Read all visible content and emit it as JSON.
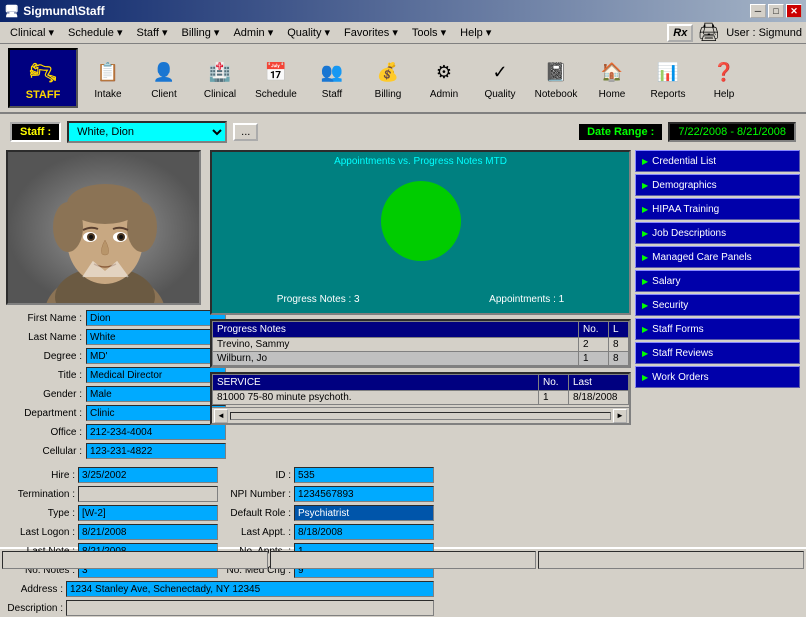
{
  "titlebar": {
    "title": "Sigmund\\Staff",
    "min": "─",
    "max": "□",
    "close": "✕"
  },
  "menubar": {
    "items": [
      {
        "label": "Clinical"
      },
      {
        "label": "Schedule"
      },
      {
        "label": "Staff"
      },
      {
        "label": "Billing"
      },
      {
        "label": "Admin"
      },
      {
        "label": "Quality"
      },
      {
        "label": "Favorites"
      },
      {
        "label": "Tools"
      },
      {
        "label": "Help"
      }
    ]
  },
  "toolbar": {
    "staff_label": "STAFF",
    "items": [
      {
        "label": "Intake",
        "icon": "📋"
      },
      {
        "label": "Client",
        "icon": "👤"
      },
      {
        "label": "Clinical",
        "icon": "🏥"
      },
      {
        "label": "Schedule",
        "icon": "📅"
      },
      {
        "label": "Staff",
        "icon": "👥"
      },
      {
        "label": "Billing",
        "icon": "💰"
      },
      {
        "label": "Admin",
        "icon": "⚙"
      },
      {
        "label": "Quality",
        "icon": "✓"
      },
      {
        "label": "Notebook",
        "icon": "📓"
      },
      {
        "label": "Home",
        "icon": "🏠"
      },
      {
        "label": "Reports",
        "icon": "📊"
      },
      {
        "label": "Help",
        "icon": "❓"
      }
    ],
    "rx_symbol": "Rx",
    "user_label": "User : Sigmund"
  },
  "selector": {
    "staff_label": "Staff :",
    "selected_staff": "White, Dion",
    "dots": "...",
    "date_range_label": "Date Range :",
    "date_range": "7/22/2008 - 8/21/2008"
  },
  "staff_info": {
    "first_name_label": "First Name :",
    "first_name": "Dion",
    "last_name_label": "Last Name :",
    "last_name": "White",
    "degree_label": "Degree :",
    "degree": "MD'",
    "title_label": "Title :",
    "title": "Medical Director",
    "gender_label": "Gender :",
    "gender": "Male",
    "department_label": "Department :",
    "department": "Clinic",
    "office_label": "Office :",
    "office": "212-234-4004",
    "cellular_label": "Cellular :",
    "cellular": "123-231-4822"
  },
  "staff_details": {
    "hire_label": "Hire :",
    "hire": "3/25/2002",
    "id_label": "ID :",
    "id": "535",
    "termination_label": "Termination :",
    "termination": "",
    "npi_label": "NPI Number :",
    "npi": "1234567893",
    "type_label": "Type :",
    "type": "[W-2]",
    "default_role_label": "Default Role :",
    "default_role": "Psychiatrist",
    "last_logon_label": "Last Logon :",
    "last_logon": "8/21/2008",
    "last_appt_label": "Last Appt. :",
    "last_appt": "8/18/2008",
    "last_note_label": "Last Note :",
    "last_note": "8/21/2008",
    "no_appts_label": "No. Appts. :",
    "no_appts": "1",
    "no_notes_label": "No. Notes :",
    "no_notes": "3",
    "no_med_chg_label": "No. Med Chg :",
    "no_med_chg": "9",
    "address_label": "Address :",
    "address": "1234 Stanley Ave, Schenectady, NY 12345",
    "description_label": "Description :",
    "description": ""
  },
  "chart": {
    "title": "Appointments vs. Progress Notes MTD",
    "progress_notes_label": "Progress Notes : 3",
    "appointments_label": "Appointments : 1"
  },
  "progress_notes_table": {
    "headers": [
      "Progress Notes",
      "No.",
      "L"
    ],
    "rows": [
      [
        "Trevino, Sammy",
        "2",
        "8"
      ],
      [
        "Wilburn, Jo",
        "1",
        "8"
      ]
    ]
  },
  "service_table": {
    "headers": [
      "SERVICE",
      "No.",
      "Last"
    ],
    "rows": [
      [
        "81000 75-80 minute psychoth.",
        "1",
        "8/18/2008"
      ]
    ]
  },
  "right_panel": {
    "buttons": [
      "Credential List",
      "Demographics",
      "HIPAA Training",
      "Job Descriptions",
      "Managed Care Panels",
      "Salary",
      "Security",
      "Staff Forms",
      "Staff Reviews",
      "Work Orders"
    ]
  }
}
